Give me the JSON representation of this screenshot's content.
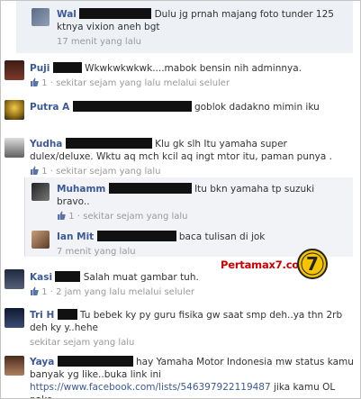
{
  "comments": [
    {
      "name": "Wal",
      "text": "Dulu jg prnah majang foto tunder 125 ktnya vixion aneh bgt",
      "meta": "17 menit yang lalu"
    },
    {
      "name": "Puji",
      "text": "Wkwkwkwkwk....mabok bensin nih adminnya.",
      "likes": "1",
      "meta": "· sekitar sejam yang lalu melalui seluler"
    },
    {
      "name": "Putra A",
      "text": "goblok dadakno mimin iku"
    },
    {
      "name": "Yudha",
      "text_1": "Klu gk slh Itu yamaha super",
      "text_2": "dulex/deluxe. Wktu aq mch kcil aq ingt mtor itu, paman punya .",
      "likes": "1",
      "meta": "· sekitar sejam yang lalu"
    },
    {
      "name": "Muhamm",
      "text_1": "Itu bkn yamaha tp suzuki",
      "text_2": "bravo..",
      "likes": "1",
      "meta": "· sekitar sejam yang lalu"
    },
    {
      "name": "Ian Mit",
      "text": "baca tulisan di jok",
      "meta": "7 menit yang lalu"
    },
    {
      "name": "Kasi",
      "text": "Salah muat gambar tuh.",
      "likes": "1",
      "meta": "· 2 jam yang lalu melalui seluler"
    },
    {
      "name": "Tri H",
      "text_1": "Tu bebek ky py guru fisika gw saat smp deh..ya thn 2rb",
      "text_2": "deh ky y..hehe",
      "meta": "sekitar sejam yang lalu"
    },
    {
      "name": "Yaya",
      "text_1": "hay Yamaha Motor Indonesia mw status kamu",
      "text_2": "banyak yg like..buka link ini",
      "link": "https://www.facebook.com/lists/546397922119487",
      "text_3": "jika kamu OL pake"
    }
  ],
  "watermark": {
    "text": "Pertamax7.com",
    "badge": "7"
  }
}
